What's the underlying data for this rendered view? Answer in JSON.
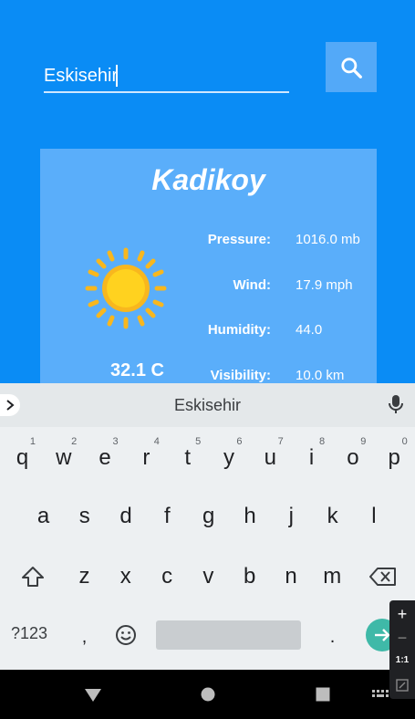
{
  "search": {
    "value": "Eskisehir",
    "icon": "search-icon"
  },
  "weather": {
    "city": "Kadikoy",
    "temperature": "32.1 C",
    "icon": "sun-icon",
    "stats": [
      {
        "label": "Pressure:",
        "value": "1016.0 mb"
      },
      {
        "label": "Wind:",
        "value": "17.9 mph"
      },
      {
        "label": "Humidity:",
        "value": "44.0"
      },
      {
        "label": "Visibility:",
        "value": "10.0 km"
      }
    ]
  },
  "keyboard": {
    "suggestion": "Eskisehir",
    "row1": [
      {
        "k": "q",
        "h": "1"
      },
      {
        "k": "w",
        "h": "2"
      },
      {
        "k": "e",
        "h": "3"
      },
      {
        "k": "r",
        "h": "4"
      },
      {
        "k": "t",
        "h": "5"
      },
      {
        "k": "y",
        "h": "6"
      },
      {
        "k": "u",
        "h": "7"
      },
      {
        "k": "i",
        "h": "8"
      },
      {
        "k": "o",
        "h": "9"
      },
      {
        "k": "p",
        "h": "0"
      }
    ],
    "row2": [
      "a",
      "s",
      "d",
      "f",
      "g",
      "h",
      "j",
      "k",
      "l"
    ],
    "row3": [
      "z",
      "x",
      "c",
      "v",
      "b",
      "n",
      "m"
    ],
    "symbols_label": "?123",
    "comma": ",",
    "period": "."
  },
  "emulator": {
    "plus": "+",
    "minus": "−",
    "ratio": "1:1"
  },
  "colors": {
    "app_bg": "#0a8cf5",
    "card_bg": "#5aaefa",
    "accent_enter": "#3fb9a8",
    "sun": "#ffd21f"
  }
}
